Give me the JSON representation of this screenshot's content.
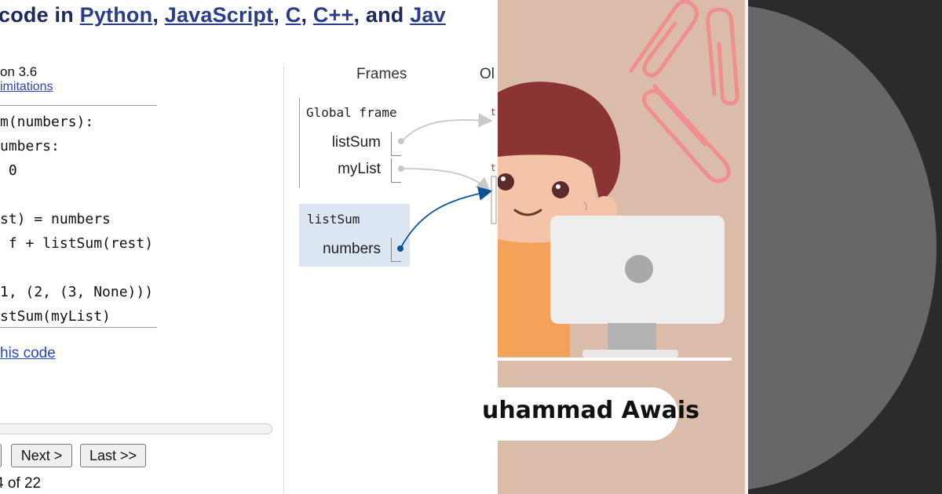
{
  "header": {
    "text_prefix": "code in ",
    "links": [
      "Python",
      "JavaScript",
      "C",
      "C++"
    ],
    "sep1": ", ",
    "sep2": ", ",
    "sep3": ", ",
    "and_text": ", and ",
    "truncated_link": "Jav"
  },
  "editor": {
    "version_text": "on 3.6",
    "limitations_link": "imitations",
    "code_lines": [
      "m(numbers):",
      "umbers:",
      " 0",
      "",
      "st) = numbers",
      " f + listSum(rest)",
      "",
      "1, (2, (3, None)))",
      "stSum(myList)"
    ],
    "edit_link": "his code"
  },
  "controls": {
    "prev_label": "",
    "next_label": "Next >",
    "last_label": "Last >>",
    "step_text": "4 of 22"
  },
  "viz": {
    "frames_header": "Frames",
    "objects_header": "Ol",
    "global_frame_label": "Global frame",
    "global_vars": [
      "listSum",
      "myList"
    ],
    "listsum_frame_label": "listSum",
    "listsum_vars": [
      "numbers"
    ],
    "pointer_colors": {
      "global": "#c8c8c8",
      "active": "#0b5394"
    }
  },
  "thumbnail": {
    "author_name": "uhammad Awais",
    "background_color": "#dbbcab",
    "illustration": "boy-at-laptop",
    "decor": "paperclips"
  },
  "right_panel": {
    "background_color": "#2b2b2b",
    "circle_color": "#676767"
  }
}
